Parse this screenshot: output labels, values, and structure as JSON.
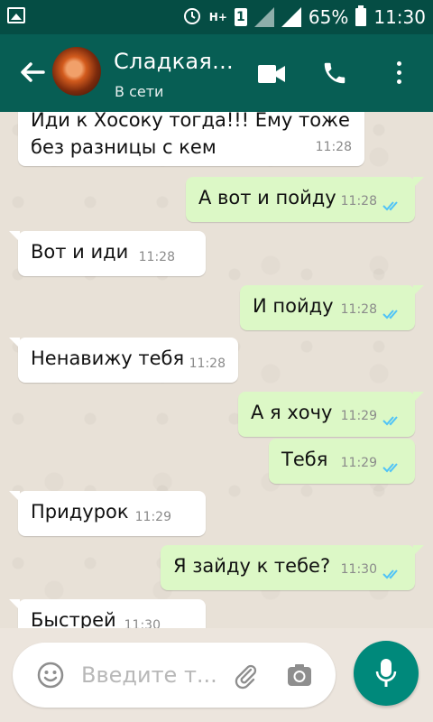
{
  "status_bar": {
    "battery_text": "65%",
    "time": "11:30",
    "sim_label": "1",
    "network_label": "H+"
  },
  "header": {
    "contact_name": "Сладкая...",
    "presence": "В сети"
  },
  "messages": [
    {
      "direction": "in",
      "text": "Иди к Хосоку тогда!!! Ему тоже\nбез разницы с кем",
      "time": "11:28"
    },
    {
      "direction": "out",
      "text": "А вот и пойду",
      "time": "11:28",
      "read": true
    },
    {
      "direction": "in",
      "text": "Вот и иди",
      "time": "11:28"
    },
    {
      "direction": "out",
      "text": "И пойду",
      "time": "11:28",
      "read": true
    },
    {
      "direction": "in",
      "text": "Ненавижу тебя",
      "time": "11:28"
    },
    {
      "direction": "out",
      "text": "А я хочу",
      "time": "11:29",
      "read": true
    },
    {
      "direction": "out",
      "text": "Тебя",
      "time": "11:29",
      "read": true
    },
    {
      "direction": "in",
      "text": "Придурок",
      "time": "11:29"
    },
    {
      "direction": "out",
      "text": "Я зайду к тебе?",
      "time": "11:30",
      "read": true
    },
    {
      "direction": "in",
      "text": "Быстрей",
      "time": "11:30"
    }
  ],
  "composer": {
    "placeholder": "Введите т..."
  },
  "colors": {
    "header": "#075e54",
    "status_bar": "#054d44",
    "outgoing_bubble": "#dcf8c6",
    "incoming_bubble": "#ffffff",
    "read_ticks": "#4fc3f7",
    "mic_button": "#00897b"
  },
  "icons": [
    "gallery-icon",
    "alarm-icon",
    "signal-icon",
    "battery-icon",
    "back-arrow-icon",
    "video-call-icon",
    "phone-icon",
    "more-vert-icon",
    "emoji-icon",
    "attach-icon",
    "camera-icon",
    "mic-icon",
    "double-check-icon"
  ]
}
